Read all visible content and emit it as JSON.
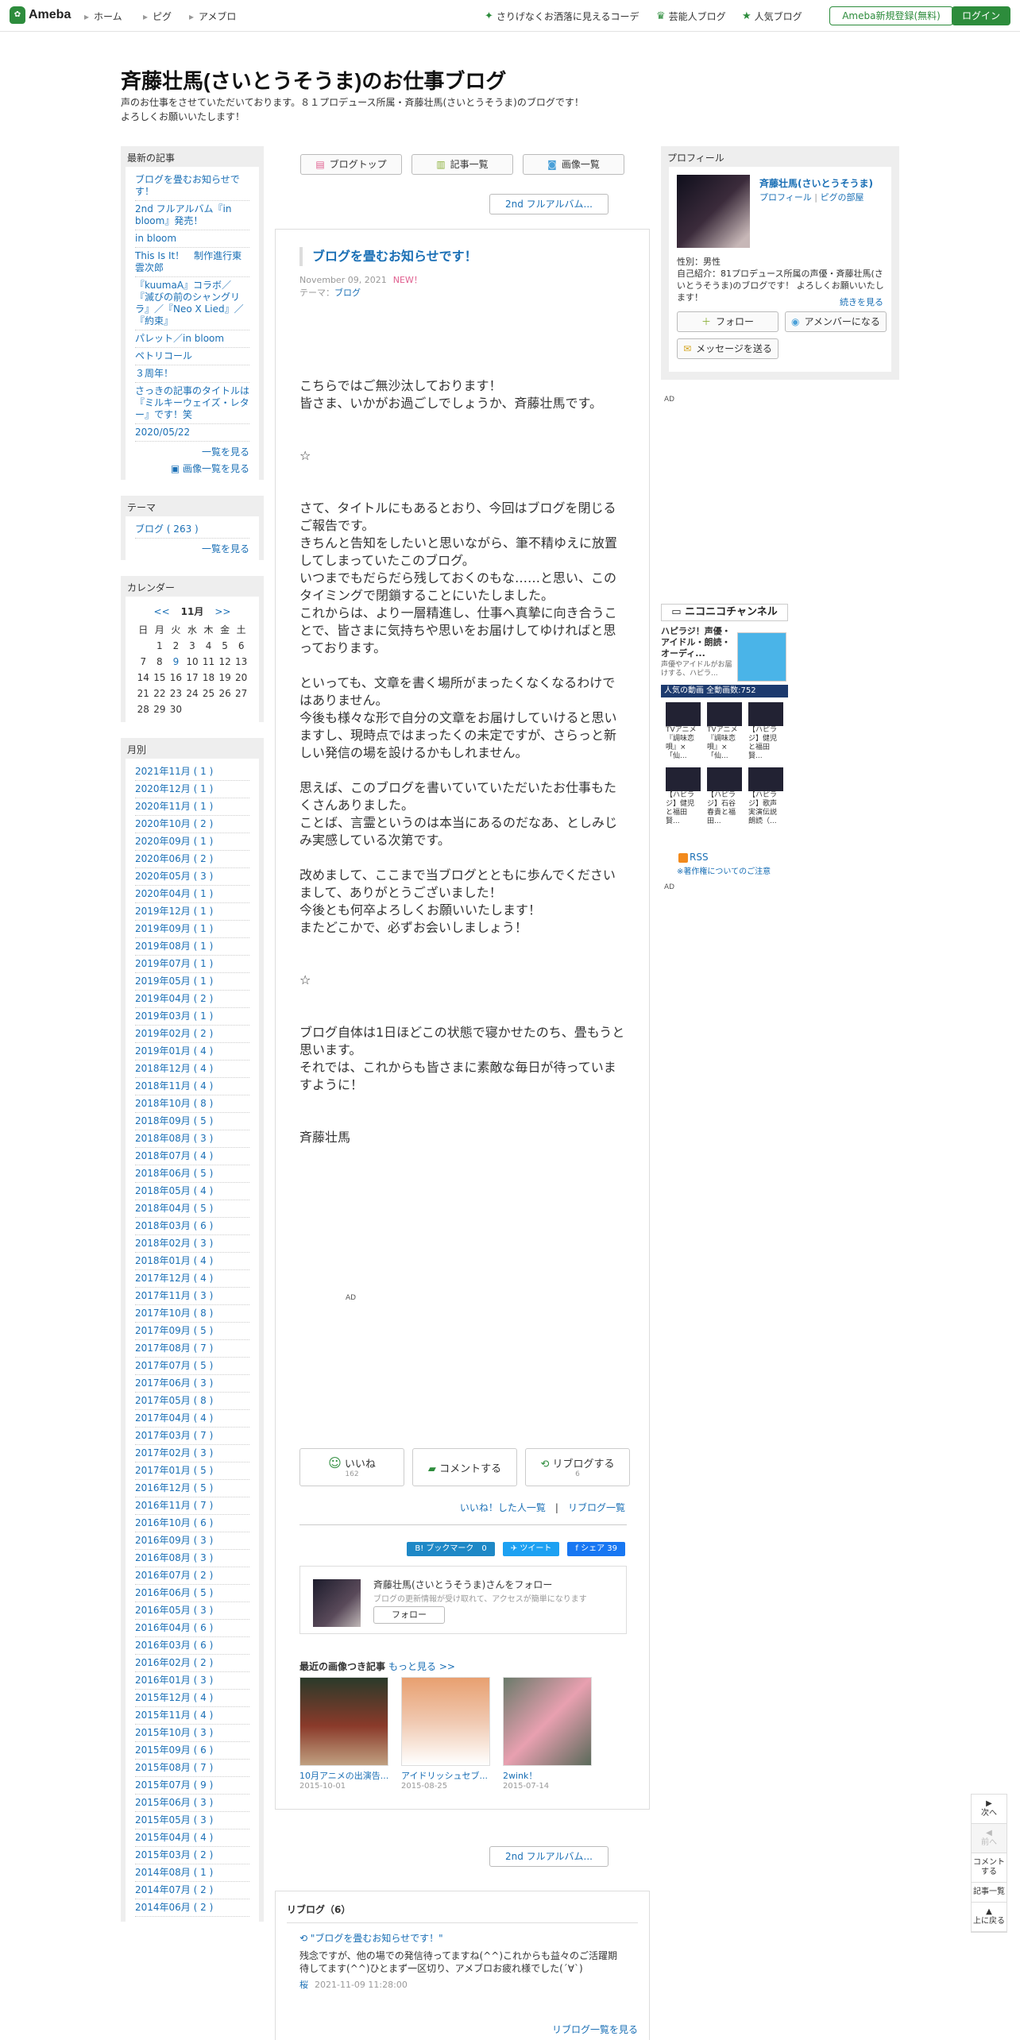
{
  "topbar": {
    "logo": "Ameba",
    "nav": [
      "ホーム",
      "ピグ",
      "アメブロ"
    ],
    "right": [
      "さりげなくお洒落に見えるコーデ",
      "芸能人ブログ",
      "人気ブログ"
    ],
    "register": "Ameba新規登録(無料)",
    "login": "ログイン"
  },
  "blog": {
    "title": "斉藤壮馬(さいとうそうま)のお仕事ブログ",
    "desc1": "声のお仕事をさせていただいております。８１プロデュース所属・斉藤壮馬(さいとうそうま)のブログです！",
    "desc2": "よろしくお願いいたします！"
  },
  "left": {
    "recent": {
      "title": "最新の記事",
      "items": [
        "ブログを畳むお知らせです！",
        "2nd フルアルバム『in bloom』発売！",
        "in bloom",
        "This Is It！　制作進行東雲次郎",
        "『kuumaA』コラボ／『滅びの前のシャングリラ』／『Neo X Lied』／『約束』",
        "パレット／in bloom",
        "ペトリコール",
        "３周年！",
        "さっきの記事のタイトルは『ミルキーウェイズ・レター』です！笑",
        "2020/05/22"
      ],
      "more": "一覧を見る",
      "more_img": "画像一覧を見る"
    },
    "theme": {
      "title": "テーマ",
      "item": "ブログ ( 263 )",
      "more": "一覧を見る"
    },
    "calendar": {
      "title": "カレンダー",
      "prev": "<<",
      "month": "11月",
      "next": ">>",
      "head": [
        "日",
        "月",
        "火",
        "水",
        "木",
        "金",
        "土"
      ],
      "rows": [
        [
          "",
          "1",
          "2",
          "3",
          "4",
          "5",
          "6"
        ],
        [
          "7",
          "8",
          "9",
          "10",
          "11",
          "12",
          "13"
        ],
        [
          "14",
          "15",
          "16",
          "17",
          "18",
          "19",
          "20"
        ],
        [
          "21",
          "22",
          "23",
          "24",
          "25",
          "26",
          "27"
        ],
        [
          "28",
          "29",
          "30",
          "",
          "",
          "",
          ""
        ]
      ]
    },
    "monthly": {
      "title": "月別",
      "items": [
        "2021年11月 ( 1 )",
        "2020年12月 ( 1 )",
        "2020年11月 ( 1 )",
        "2020年10月 ( 2 )",
        "2020年09月 ( 1 )",
        "2020年06月 ( 2 )",
        "2020年05月 ( 3 )",
        "2020年04月 ( 1 )",
        "2019年12月 ( 1 )",
        "2019年09月 ( 1 )",
        "2019年08月 ( 1 )",
        "2019年07月 ( 1 )",
        "2019年05月 ( 1 )",
        "2019年04月 ( 2 )",
        "2019年03月 ( 1 )",
        "2019年02月 ( 2 )",
        "2019年01月 ( 4 )",
        "2018年12月 ( 4 )",
        "2018年11月 ( 4 )",
        "2018年10月 ( 8 )",
        "2018年09月 ( 5 )",
        "2018年08月 ( 3 )",
        "2018年07月 ( 4 )",
        "2018年06月 ( 5 )",
        "2018年05月 ( 4 )",
        "2018年04月 ( 5 )",
        "2018年03月 ( 6 )",
        "2018年02月 ( 3 )",
        "2018年01月 ( 4 )",
        "2017年12月 ( 4 )",
        "2017年11月 ( 3 )",
        "2017年10月 ( 8 )",
        "2017年09月 ( 5 )",
        "2017年08月 ( 7 )",
        "2017年07月 ( 5 )",
        "2017年06月 ( 3 )",
        "2017年05月 ( 8 )",
        "2017年04月 ( 4 )",
        "2017年03月 ( 7 )",
        "2017年02月 ( 3 )",
        "2017年01月 ( 5 )",
        "2016年12月 ( 5 )",
        "2016年11月 ( 7 )",
        "2016年10月 ( 6 )",
        "2016年09月 ( 3 )",
        "2016年08月 ( 3 )",
        "2016年07月 ( 2 )",
        "2016年06月 ( 5 )",
        "2016年05月 ( 3 )",
        "2016年04月 ( 6 )",
        "2016年03月 ( 6 )",
        "2016年02月 ( 2 )",
        "2016年01月 ( 3 )",
        "2015年12月 ( 4 )",
        "2015年11月 ( 4 )",
        "2015年10月 ( 3 )",
        "2015年09月 ( 6 )",
        "2015年08月 ( 7 )",
        "2015年07月 ( 9 )",
        "2015年06月 ( 3 )",
        "2015年05月 ( 3 )",
        "2015年04月 ( 4 )",
        "2015年03月 ( 2 )",
        "2014年08月 ( 1 )",
        "2014年07月 ( 2 )",
        "2014年06月 ( 2 )"
      ]
    }
  },
  "main": {
    "btns": [
      "ブログトップ",
      "記事一覧",
      "画像一覧"
    ],
    "nav_next": "2nd フルアルバム...",
    "article": {
      "title": "ブログを畳むお知らせです！",
      "date": "November 09, 2021",
      "new": "NEW！",
      "theme_label": "テーマ：",
      "theme": "ブログ",
      "body": [
        "こちらではご無沙汰しております！",
        "皆さま、いかがお過ごしでしょうか、斉藤壮馬です。",
        "",
        "",
        "☆",
        "",
        "",
        "さて、タイトルにもあるとおり、今回はブログを閉じるご報告です。",
        "きちんと告知をしたいと思いながら、筆不精ゆえに放置してしまっていたこのブログ。",
        "いつまでもだらだら残しておくのもな……と思い、このタイミングで閉鎖することにいたしました。",
        "これからは、より一層精進し、仕事へ真摯に向き合うことで、皆さまに気持ちや思いをお届けしてゆければと思っております。",
        "",
        "といっても、文章を書く場所がまったくなくなるわけではありません。",
        "今後も様々な形で自分の文章をお届けしていけると思いますし、現時点ではまったくの未定ですが、さらっと新しい発信の場を設けるかもしれません。",
        "",
        "思えば、このブログを書いていていただいたお仕事もたくさんありました。",
        "ことば、言霊というのは本当にあるのだなあ、としみじみ実感している次第です。",
        "",
        "改めまして、ここまで当ブログとともに歩んでくださいまして、ありがとうございました！",
        "今後とも何卒よろしくお願いいたします！",
        "またどこかで、必ずお会いしましょう！",
        "",
        "",
        "☆",
        "",
        "",
        "ブログ自体は1日ほどこの状態で寝かせたのち、畳もうと思います。",
        "それでは、これからも皆さまに素敵な毎日が待っていますように！",
        "",
        "",
        "斉藤壮馬"
      ],
      "ad": "AD",
      "like": "いいね",
      "like_count": "162",
      "comment": "コメントする",
      "reblog": "リブログする",
      "reblog_count": "6",
      "liked_by": "いいね！した人一覧",
      "sep": "|",
      "reblog_list": "リブログ一覧",
      "share_hatena": "B! ブックマーク",
      "share_hatena_count": "0",
      "share_tw": "ツイート",
      "share_fb": "シェア",
      "share_fb_count": "39",
      "follow_t1": "斉藤壮馬(さいとうそうま)さんをフォロー",
      "follow_t2": "ブログの更新情報が受け取れて、アクセスが簡単になります",
      "follow_btn": "フォロー",
      "recent_title": "最近の画像つき記事",
      "recent_more": "もっと見る >>",
      "thumbs": [
        {
          "cap": "10月アニメの出演告...",
          "date": "2015-10-01"
        },
        {
          "cap": "アイドリッシュセブ...",
          "date": "2015-08-25"
        },
        {
          "cap": "2wink！",
          "date": "2015-07-14"
        }
      ]
    },
    "reblog_box": {
      "title": "リブログ（6）",
      "rt": "\"ブログを畳むお知らせです！\"",
      "rx": "残念ですが、他の場での発信待ってますね(^^)これからも益々のご活躍期待してます(^^)ひとまず一区切り、アメブロお疲れ様でした(´∀`)",
      "author": "桜",
      "time": "2021-11-09 11:28:00",
      "more": "リブログ一覧を見る"
    }
  },
  "right": {
    "profile": {
      "title": "プロフィール",
      "name": "斉藤壮馬(さいとうそうま)",
      "link1": "プロフィール",
      "sep": "|",
      "link2": "ピグの部屋",
      "gender": "性別：男性",
      "intro": "自己紹介：81プロデュース所属の声優・斉藤壮馬(さいとうそうま)のブログです！ よろしくお願いいたします！",
      "more": "続きを見る",
      "follow": "フォロー",
      "member": "アメンバーになる",
      "message": "メッセージを送る"
    },
    "ad1": "AD",
    "nico": {
      "header": "ニコニコチャンネル",
      "title": "ハピラジ！声優・アイドル・朗読・オーディ...",
      "desc": "声優やアイドルがお届けする、ハピラ...",
      "bar": "人気の動画 全動画数:752",
      "videos": [
        "TVアニメ『調味恋唄』×「仙...",
        "TVアニメ『調味恋唄』×「仙...",
        "【ハピラジ】健児と福田賢...",
        "【ハピラジ】健児と福田賢...",
        "【ハピラジ】石谷春貴と福田...",
        "【ハピラジ】歌声実演伝説 朗読（..."
      ]
    },
    "rss": "RSS",
    "rss_note": "※著作権についてのご注意",
    "ad2": "AD"
  },
  "sidebtns": {
    "next": "次へ",
    "prev": "前へ",
    "comment": "コメントする",
    "list": "記事一覧",
    "top": "上に戻る"
  }
}
